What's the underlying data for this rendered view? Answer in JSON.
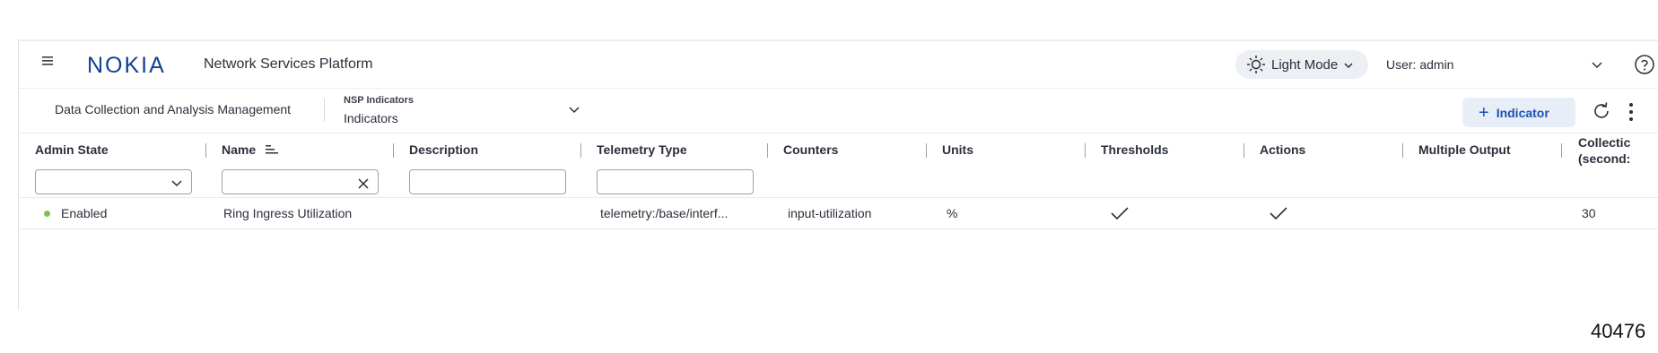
{
  "header": {
    "logo_text": "NOKIA",
    "app_title": "Network Services Platform",
    "theme_label": "Light Mode",
    "user_label": "User: admin"
  },
  "subheader": {
    "breadcrumb": "Data Collection and Analysis Management",
    "view_overline": "NSP Indicators",
    "view_value": "Indicators",
    "add_button_label": "Indicator",
    "add_button_icon": "+"
  },
  "table": {
    "columns": [
      {
        "label": "Admin State"
      },
      {
        "label": "Name"
      },
      {
        "label": "Description"
      },
      {
        "label": "Telemetry Type"
      },
      {
        "label": "Counters"
      },
      {
        "label": "Units"
      },
      {
        "label": "Thresholds"
      },
      {
        "label": "Actions"
      },
      {
        "label": "Multiple Output"
      },
      {
        "label": "Collection (seconds)"
      }
    ],
    "last_column_line1": "Collectic",
    "last_column_line2": "(second:",
    "rows": [
      {
        "admin_state": "Enabled",
        "name": "Ring Ingress Utilization",
        "description": "",
        "telemetry_type": "telemetry:/base/interf...",
        "counters": "input-utilization",
        "units": "%",
        "thresholds": true,
        "actions": true,
        "multiple_output": "",
        "collection": "30"
      }
    ]
  },
  "colors": {
    "accent": "#1d52b5",
    "status_enabled": "#7cc44d",
    "logo": "#124191"
  },
  "footer_number": "40476"
}
